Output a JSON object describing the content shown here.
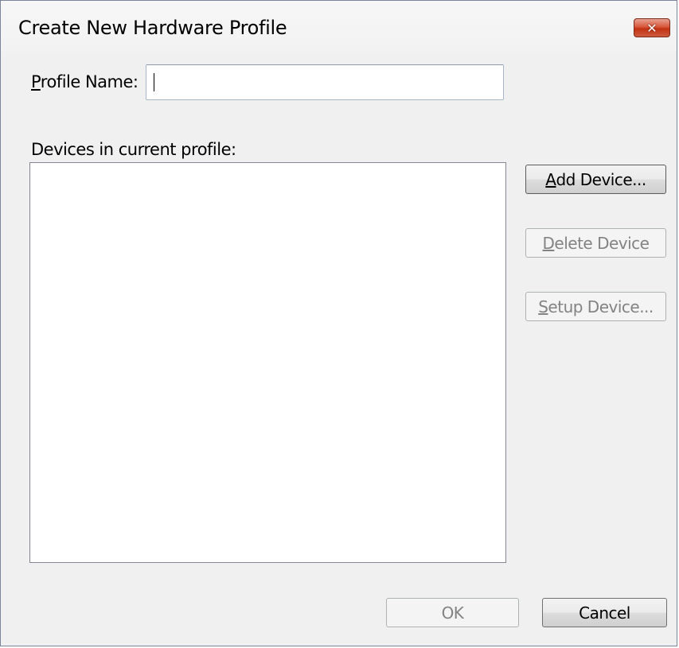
{
  "window": {
    "title": "Create New Hardware Profile",
    "close_glyph": "✕"
  },
  "form": {
    "profile_name_label_mnemonic": "P",
    "profile_name_label_rest": "rofile Name:",
    "profile_name_value": "",
    "devices_label": "Devices in current profile:",
    "devices": []
  },
  "buttons": {
    "add_device": {
      "mnemonic": "A",
      "rest": "dd Device...",
      "enabled": true
    },
    "delete_device": {
      "mnemonic": "D",
      "rest": "elete Device",
      "enabled": false
    },
    "setup_device": {
      "mnemonic": "S",
      "rest": "etup Device...",
      "enabled": false
    },
    "ok": {
      "label": "OK",
      "enabled": false
    },
    "cancel": {
      "label": "Cancel",
      "enabled": true
    }
  },
  "icons": {
    "close": "close-icon"
  }
}
